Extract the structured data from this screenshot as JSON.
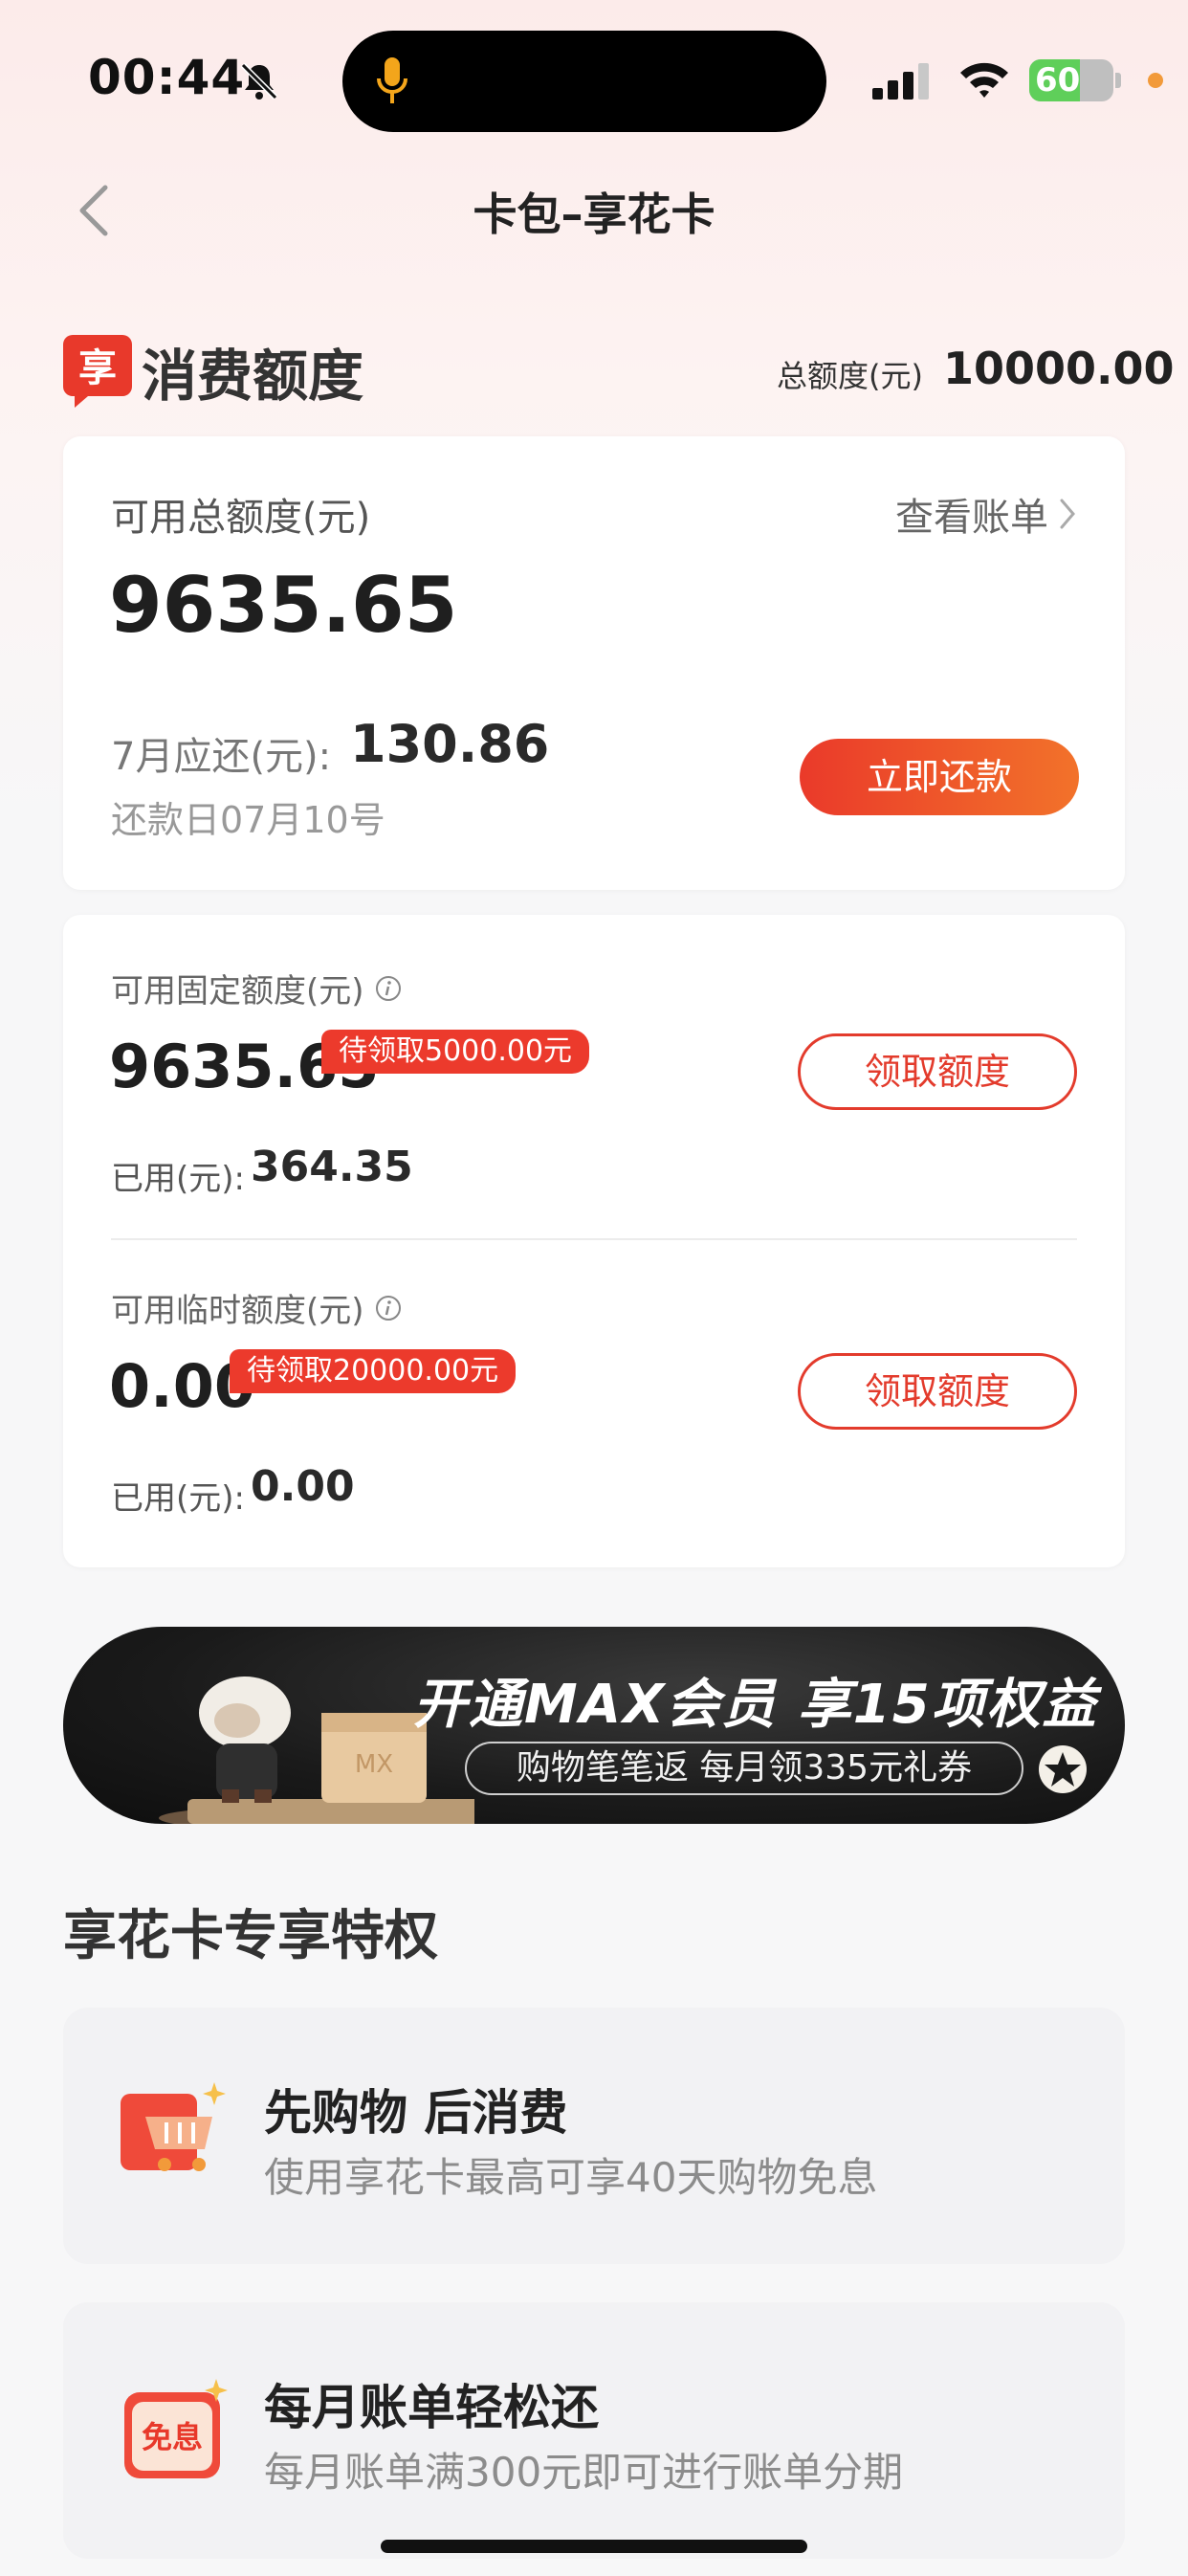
{
  "status_bar": {
    "time": "00:44",
    "battery": "60",
    "battery_level": 0.6
  },
  "nav": {
    "title": "卡包–享花卡"
  },
  "credit": {
    "logo_char": "享",
    "title": "消费额度",
    "total_label": "总额度(元)",
    "total_value": "10000.00"
  },
  "summary": {
    "avail_label": "可用总额度(元)",
    "view_bill": "查看账单",
    "avail_amount": "9635.65",
    "month_due_label": "7月应还(元):",
    "month_due_value": "130.86",
    "due_date": "还款日07月10号",
    "repay_button": "立即还款"
  },
  "fixed_limit": {
    "label": "可用固定额度(元)",
    "amount": "9635.65",
    "pending": "待领取5000.00元",
    "used_label": "已用(元):",
    "used_value": "364.35",
    "claim_button": "领取额度"
  },
  "temp_limit": {
    "label": "可用临时额度(元)",
    "amount": "0.00",
    "pending": "待领取20000.00元",
    "used_label": "已用(元):",
    "used_value": "0.00",
    "claim_button": "领取额度"
  },
  "banner": {
    "headline": "开通MAX会员 享15项权益",
    "subline": "购物笔笔返 每月领335元礼券",
    "box_text": "MX"
  },
  "privileges": {
    "title": "享花卡专享特权",
    "items": [
      {
        "heading": "先购物 后消费",
        "desc": "使用享花卡最高可享40天购物免息",
        "icon": "shopping-cart-icon"
      },
      {
        "heading": "每月账单轻松还",
        "desc": "每月账单满300元即可进行账单分期",
        "icon_text": "免息",
        "icon": "interest-free-icon"
      }
    ]
  },
  "colors": {
    "accent": "#E8392B",
    "accent_gradient_end": "#F2722A",
    "battery_green": "#5FCF5A"
  }
}
